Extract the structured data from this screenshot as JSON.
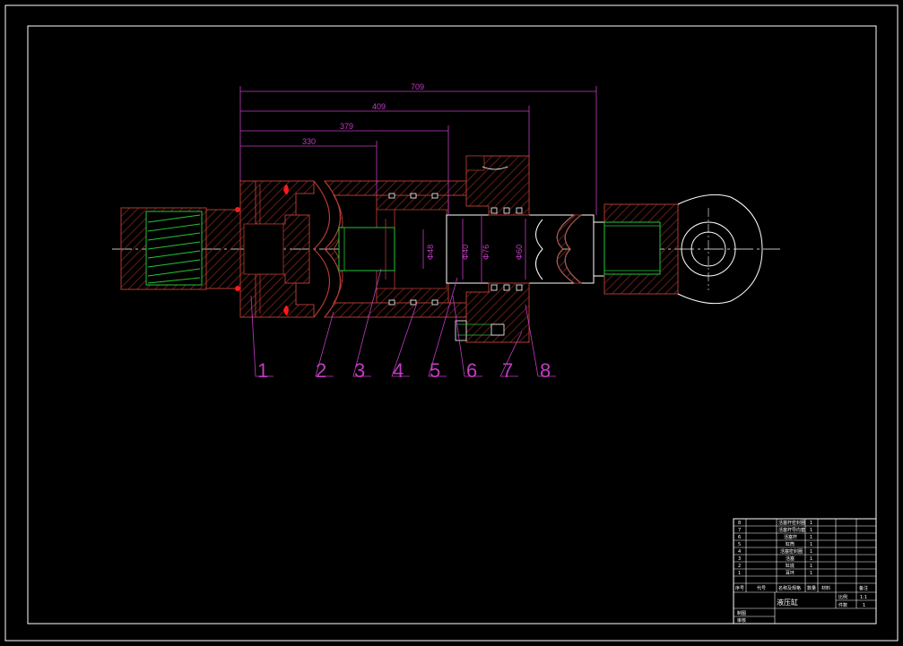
{
  "colors": {
    "background": "#000000",
    "frame": "#ffffff",
    "dimension": "#c23cc2",
    "section_outline": "#b03a2e",
    "hatch": "#8a2a20",
    "thread": "#22c53a",
    "marker": "#ff1a1a"
  },
  "dimensions": {
    "overall": "709",
    "d409": "409",
    "d379": "379",
    "d330": "330"
  },
  "diameters": {
    "a": "Φ48",
    "b": "Φ40",
    "c": "Φ76",
    "d": "Φ60"
  },
  "balloons": [
    "1",
    "2",
    "3",
    "4",
    "5",
    "6",
    "7",
    "8"
  ],
  "title_block": {
    "title": "液压缸",
    "ratio_label": "比例",
    "ratio": "1:1",
    "count_label": "件数",
    "count": "1",
    "header": [
      "序号",
      "代号",
      "名称及规格",
      "数量",
      "材料",
      "备注"
    ],
    "drawn_label": "制图",
    "checked_label": "审核",
    "parts": [
      {
        "no": "8",
        "name": "活塞杆密封圈",
        "qty": "1"
      },
      {
        "no": "7",
        "name": "活塞杆导向套",
        "qty": "1"
      },
      {
        "no": "6",
        "name": "活塞杆",
        "qty": "1"
      },
      {
        "no": "5",
        "name": "缸筒",
        "qty": "1"
      },
      {
        "no": "4",
        "name": "活塞密封圈",
        "qty": "1"
      },
      {
        "no": "3",
        "name": "活塞",
        "qty": "1"
      },
      {
        "no": "2",
        "name": "缸底",
        "qty": "1"
      },
      {
        "no": "1",
        "name": "耳环",
        "qty": "1"
      }
    ]
  }
}
